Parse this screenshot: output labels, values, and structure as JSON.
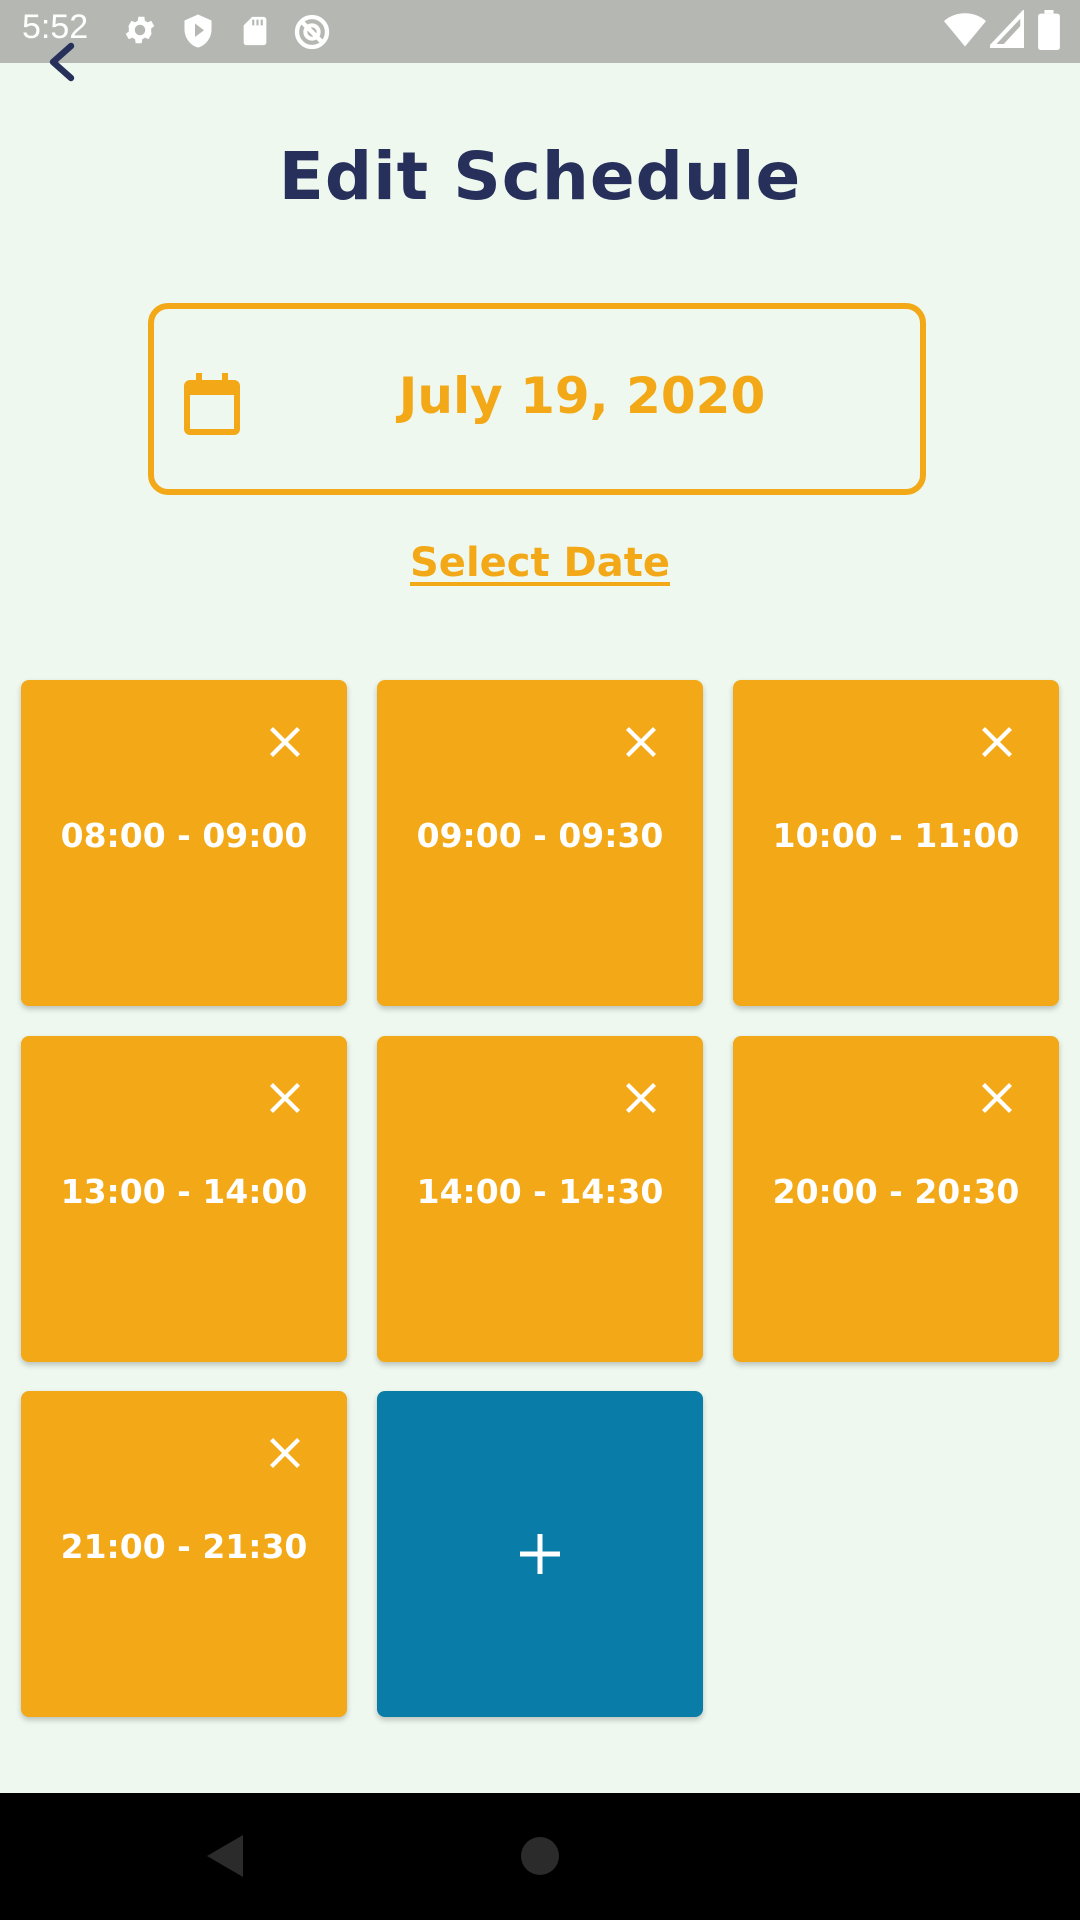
{
  "status_bar": {
    "time": "5:52",
    "left_icons": [
      "gear-icon",
      "shield-icon",
      "sd-card-icon",
      "no-sync-icon"
    ],
    "right_icons": [
      "wifi-icon",
      "signal-icon",
      "battery-icon"
    ]
  },
  "header": {
    "back_icon": "chevron-left-icon",
    "title": "Edit Schedule"
  },
  "date_picker": {
    "icon": "calendar-icon",
    "value": "July 19, 2020",
    "select_label": "Select Date"
  },
  "slots": [
    {
      "label": "08:00 - 09:00"
    },
    {
      "label": "09:00 - 09:30"
    },
    {
      "label": "10:00 - 11:00"
    },
    {
      "label": "13:00 - 14:00"
    },
    {
      "label": "14:00 - 14:30"
    },
    {
      "label": "20:00 - 20:30"
    },
    {
      "label": "21:00 - 21:30"
    }
  ],
  "add_slot_icon": "plus-icon",
  "nav_bar": {
    "icons": [
      "back-triangle-icon",
      "home-circle-icon"
    ]
  },
  "colors": {
    "background": "#eef8ee",
    "accent": "#f2a817",
    "title": "#27305a",
    "add_button": "#0a7ca8",
    "status_bar": "#b5b8b2"
  }
}
